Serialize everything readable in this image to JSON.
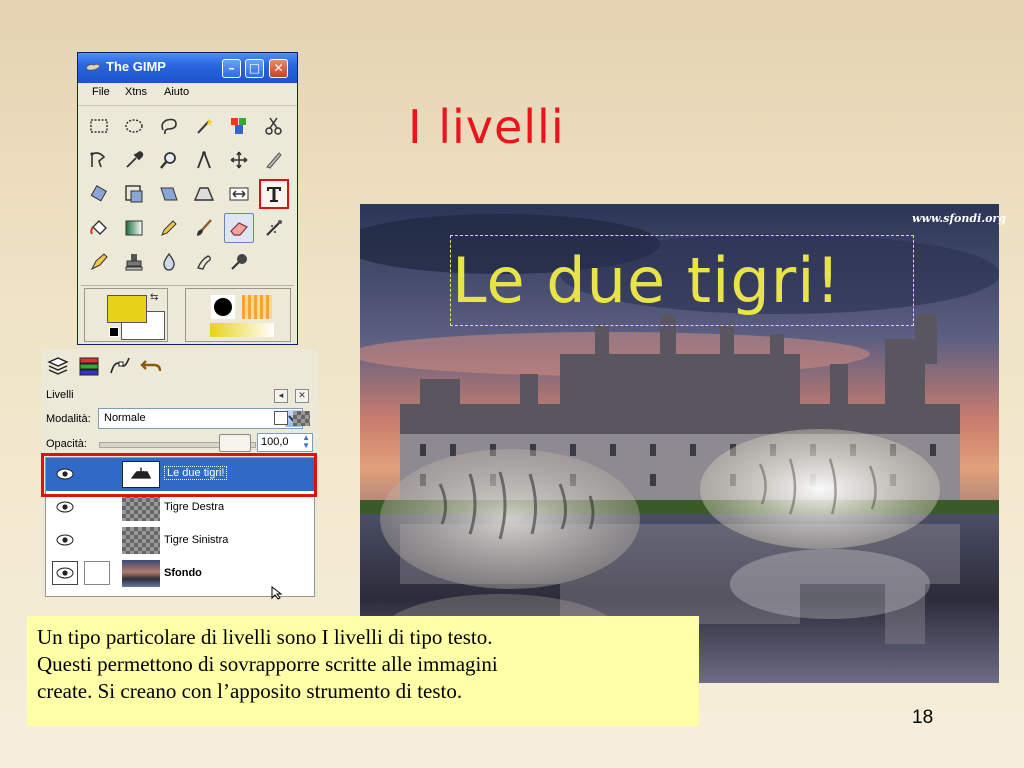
{
  "slide": {
    "title": "I livelli",
    "number": "18"
  },
  "gimp": {
    "window_title": "The GIMP",
    "menu": [
      "File",
      "Xtns",
      "Aiuto"
    ],
    "tools": [
      "rect-select",
      "ellipse-select",
      "lasso",
      "fuzzy-select",
      "color-select",
      "scissors",
      "paths",
      "color-picker",
      "zoom",
      "measure",
      "move",
      "crop",
      "rotate",
      "scale",
      "shear",
      "perspective",
      "flip",
      "text",
      "bucket-fill",
      "blend",
      "pencil",
      "paintbrush",
      "eraser",
      "airbrush",
      "ink",
      "clone",
      "blur",
      "smudge",
      "dodge-burn"
    ],
    "colors": {
      "foreground": "#e8d21a",
      "background": "#ffffff"
    }
  },
  "layers": {
    "panel_label": "Livelli",
    "mode_label": "Modalità:",
    "mode_value": "Normale",
    "opacity_label": "Opacità:",
    "opacity_value": "100,0",
    "items": [
      {
        "name": "Le due tigri!",
        "selected": true
      },
      {
        "name": "Tigre Destra",
        "selected": false
      },
      {
        "name": "Tigre Sinistra",
        "selected": false
      },
      {
        "name": "Sfondo",
        "selected": false
      }
    ]
  },
  "canvas": {
    "text": "Le due tigri!",
    "watermark": "www.sfondi.org"
  },
  "caption": {
    "lines": [
      "Un tipo particolare di livelli sono I livelli di tipo testo.",
      "Questi permettono di sovrapporre scritte alle immagini",
      "create. Si creano con l’apposito strumento di testo."
    ]
  },
  "colors": {
    "title_red": "#e8151c",
    "highlight_red": "#e01010",
    "xp_blue": "#2a66e0",
    "caption_bg": "#ffffa8",
    "canvas_text": "#e9e34a"
  }
}
